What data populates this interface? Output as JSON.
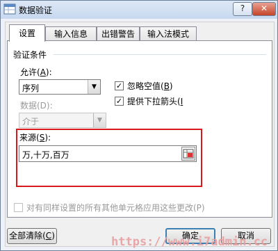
{
  "window": {
    "title": "数据验证",
    "help_label": "?",
    "close_label": "✕"
  },
  "tabs": [
    {
      "label": "设置",
      "active": true
    },
    {
      "label": "输入信息",
      "active": false
    },
    {
      "label": "出错警告",
      "active": false
    },
    {
      "label": "输入法模式",
      "active": false
    }
  ],
  "settings": {
    "group_label": "验证条件",
    "allow": {
      "label": "允许(",
      "accel": "A",
      "suffix": "):",
      "value": "序列"
    },
    "data": {
      "label": "数据(D):",
      "value": "介于",
      "disabled": true
    },
    "ignore_blank": {
      "label": "忽略空值(",
      "accel": "B",
      "suffix": ")",
      "checked": true
    },
    "in_cell_dropdown": {
      "label": "提供下拉箭头(",
      "accel": "I",
      "suffix": "",
      "checked": true
    },
    "source": {
      "label": "来源(",
      "accel": "S",
      "suffix": "):",
      "value": "万,十万,百万"
    },
    "apply_all": {
      "label": "对有同样设置的所有其他单元格应用这些更改(P)",
      "checked": false,
      "disabled": true
    }
  },
  "buttons": {
    "clear_all": {
      "label": "全部清除(",
      "accel": "C",
      "suffix": ")"
    },
    "ok": "确定",
    "cancel": "取消"
  },
  "watermark": {
    "text": "https://www.i7admin.cc",
    "color": "#e8a0a0"
  },
  "colors": {
    "highlight_frame": "#d7191c",
    "default_button_border": "#3c7fb1"
  }
}
